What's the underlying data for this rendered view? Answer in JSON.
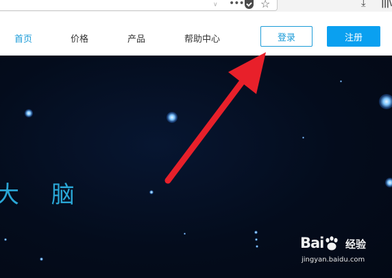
{
  "nav": {
    "items": [
      {
        "label": "首页",
        "active": true
      },
      {
        "label": "价格",
        "active": false
      },
      {
        "label": "产品",
        "active": false
      },
      {
        "label": "帮助中心",
        "active": false
      }
    ],
    "login_label": "登录",
    "register_label": "注册"
  },
  "hero": {
    "title": "大 脑"
  },
  "browser": {
    "icons": [
      "chevron-down-icon",
      "more-options-icon",
      "pocket-icon",
      "bookmark-star-icon",
      "download-icon",
      "library-icon"
    ]
  },
  "watermark": {
    "brand": "Bai",
    "brand_suffix": "经验",
    "domain": "jingyan.baidu.com"
  },
  "colors": {
    "accent": "#1a9bd8",
    "register_bg": "#0aa0f0",
    "hero_bg": "#040c1c",
    "arrow": "#e8202a"
  }
}
